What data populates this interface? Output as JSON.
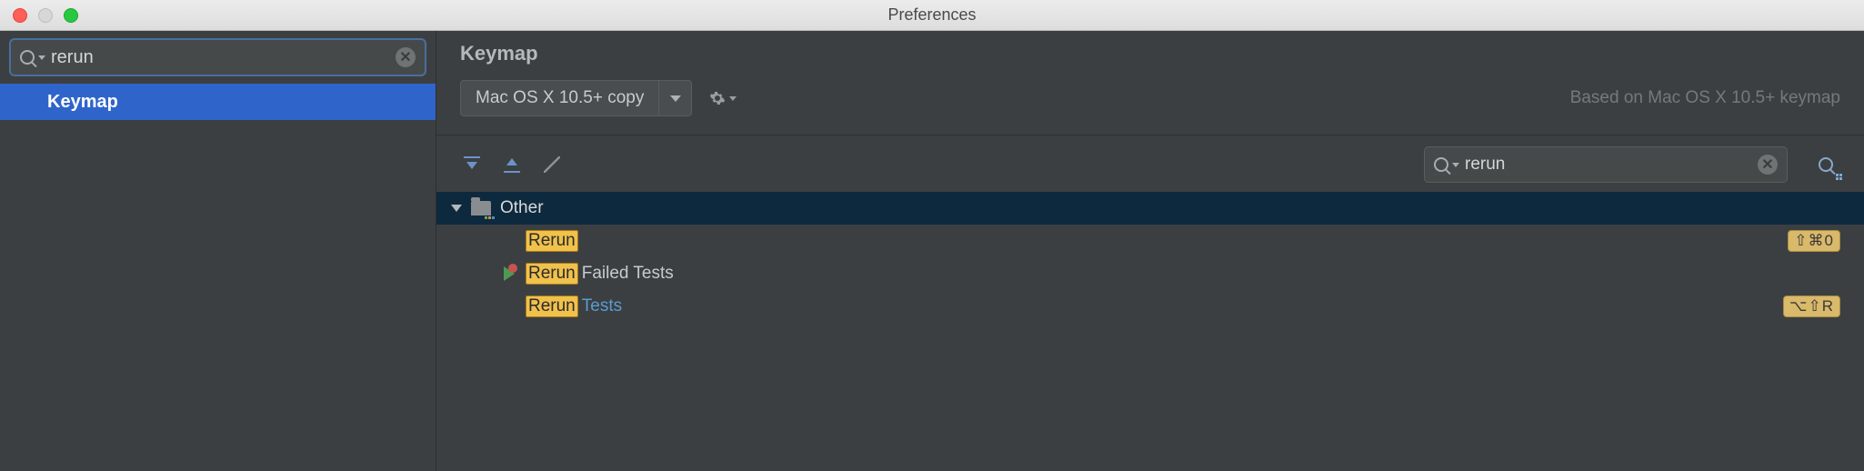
{
  "window": {
    "title": "Preferences"
  },
  "sidebar": {
    "search_value": "rerun",
    "items": [
      {
        "label": "Keymap",
        "selected": true
      }
    ]
  },
  "main": {
    "heading": "Keymap",
    "scheme": {
      "selected": "Mac OS X 10.5+ copy",
      "based_on": "Based on  Mac OS X 10.5+ keymap"
    },
    "tree_search_value": "rerun",
    "group_label": "Other",
    "actions": [
      {
        "icon": null,
        "highlight": "Rerun",
        "rest": "",
        "rest_link": false,
        "shortcut": "⇧⌘0"
      },
      {
        "icon": "rerun-failed",
        "highlight": "Rerun",
        "rest": "Failed Tests",
        "rest_link": false,
        "shortcut": ""
      },
      {
        "icon": null,
        "highlight": "Rerun",
        "rest": "Tests",
        "rest_link": true,
        "shortcut": "⌥⇧R"
      }
    ]
  }
}
